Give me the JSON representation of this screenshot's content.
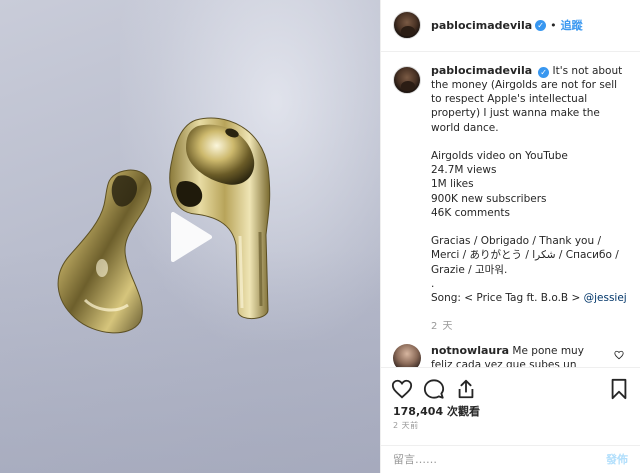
{
  "author": {
    "username": "pablocimadevila",
    "verified_icon": "verified-badge-icon",
    "follow_label": "追蹤",
    "separator": "•"
  },
  "caption": {
    "username": "pablocimadevila",
    "text_before_mention": "It's not about the money (Airgolds are not for sell to respect Apple's intellectual property) I just wanna make the world dance.\n\nAirgolds video on YouTube\n24.7M views\n1M likes\n900K new subscribers\n46K comments\n\nGracias / Obrigado / Thank you / Merci / ありがとう / شكرا / Спасибо / Grazie / 고마워.\n.\nSong: < Price Tag ft. B.o.B > ",
    "mention": "@jessiej",
    "time": "2 天"
  },
  "comment": {
    "username": "notnowlaura",
    "text": "Me pone muy feliz cada vez que subes un video u sa"
  },
  "actions": {
    "like_icon": "heart-icon",
    "comment_icon": "comment-icon",
    "share_icon": "share-icon",
    "save_icon": "bookmark-icon"
  },
  "views": {
    "count": "178,404",
    "label": "次觀看"
  },
  "post_time": "2 天前",
  "add_comment": {
    "placeholder": "留言……",
    "publish_label": "發佈"
  },
  "media": {
    "play_icon": "play-icon"
  }
}
